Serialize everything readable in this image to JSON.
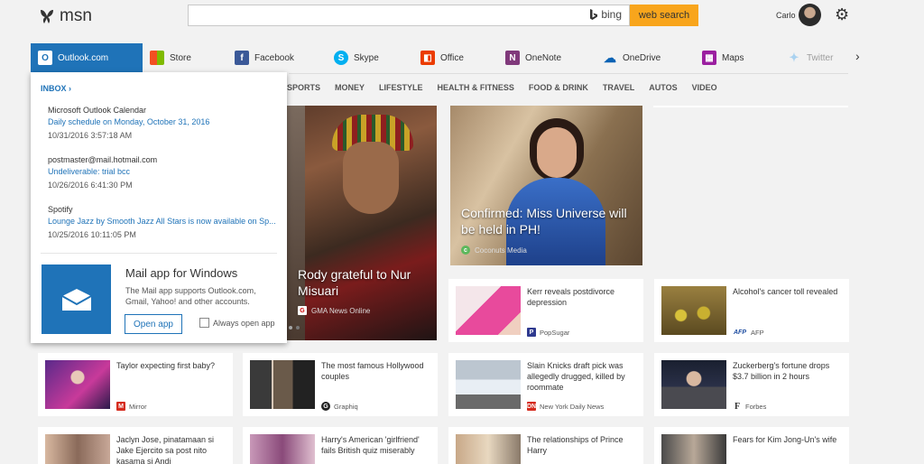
{
  "header": {
    "logo": "msn",
    "search_value": "",
    "bing_label": "bing",
    "search_button": "web search",
    "username": "Carlo"
  },
  "apps": [
    {
      "label": "Outlook.com",
      "icon": "outlook-icon",
      "color": "#1f73b8"
    },
    {
      "label": "Store",
      "icon": "store-icon",
      "color": "#f25022"
    },
    {
      "label": "Facebook",
      "icon": "facebook-icon",
      "color": "#3b5998"
    },
    {
      "label": "Skype",
      "icon": "skype-icon",
      "color": "#00aff0"
    },
    {
      "label": "Office",
      "icon": "office-icon",
      "color": "#eb3c00"
    },
    {
      "label": "OneNote",
      "icon": "onenote-icon",
      "color": "#80397b"
    },
    {
      "label": "OneDrive",
      "icon": "onedrive-icon",
      "color": "#0a62b4"
    },
    {
      "label": "Maps",
      "icon": "maps-icon",
      "color": "#9b1fa0"
    },
    {
      "label": "Twitter",
      "icon": "twitter-icon",
      "color": "#55acee"
    }
  ],
  "nav": [
    "SPORTS",
    "MONEY",
    "LIFESTYLE",
    "HEALTH & FITNESS",
    "FOOD & DRINK",
    "TRAVEL",
    "AUTOS",
    "VIDEO"
  ],
  "outlook": {
    "inbox_label": "INBOX",
    "mails": [
      {
        "from": "Microsoft Outlook Calendar",
        "subject": "Daily schedule on Monday, October 31, 2016",
        "date": "10/31/2016 3:57:18 AM"
      },
      {
        "from": "postmaster@mail.hotmail.com",
        "subject": "Undeliverable: trial bcc",
        "date": "10/26/2016 6:41:30 PM"
      },
      {
        "from": "Spotify",
        "subject": "Lounge Jazz by Smooth Jazz All Stars is now available on Sp...",
        "date": "10/25/2016 10:11:05 PM"
      }
    ],
    "mail_app": {
      "title": "Mail app for Windows",
      "description": "The Mail app supports Outlook.com, Gmail, Yahoo! and other accounts.",
      "open_button": "Open app",
      "always_open_label": "Always open app"
    }
  },
  "hero": [
    {
      "caption": "Rody grateful to Nur Misuari",
      "source": "GMA News Online"
    },
    {
      "caption": "Confirmed: Miss Universe will be held in PH!",
      "source": "Coconuts Media"
    }
  ],
  "cards": [
    {
      "title": "Kerr reveals postdivorce depression",
      "source": "PopSugar",
      "badge": "P",
      "badge_color": "#2f3a8f"
    },
    {
      "title": "Alcohol's cancer toll revealed",
      "source": "AFP",
      "badge": "AFP",
      "badge_color": "#1f4ea1"
    },
    {
      "title": "Taylor expecting first baby?",
      "source": "Mirror",
      "badge": "M",
      "badge_color": "#d52b1e"
    },
    {
      "title": "The most famous Hollywood couples",
      "source": "Graphiq",
      "badge": "G",
      "badge_color": "#222222"
    },
    {
      "title": "Slain Knicks draft pick was allegedly drugged, killed by roommate",
      "source": "New York Daily News",
      "badge": "DN",
      "badge_color": "#d52b1e"
    },
    {
      "title": "Zuckerberg's fortune drops $3.7 billion in 2 hours",
      "source": "Forbes",
      "badge": "F",
      "badge_color": "#333333"
    },
    {
      "title": "Jaclyn Jose, pinatamaan si Jake Ejercito sa post nito kasama si Andi",
      "source": "",
      "badge": "",
      "badge_color": "#888888"
    },
    {
      "title": "Harry's American 'girlfriend' fails British quiz miserably",
      "source": "",
      "badge": "",
      "badge_color": "#888888"
    },
    {
      "title": "The relationships of Prince Harry",
      "source": "",
      "badge": "",
      "badge_color": "#888888"
    },
    {
      "title": "Fears for Kim Jong-Un's wife",
      "source": "",
      "badge": "",
      "badge_color": "#888888"
    }
  ]
}
